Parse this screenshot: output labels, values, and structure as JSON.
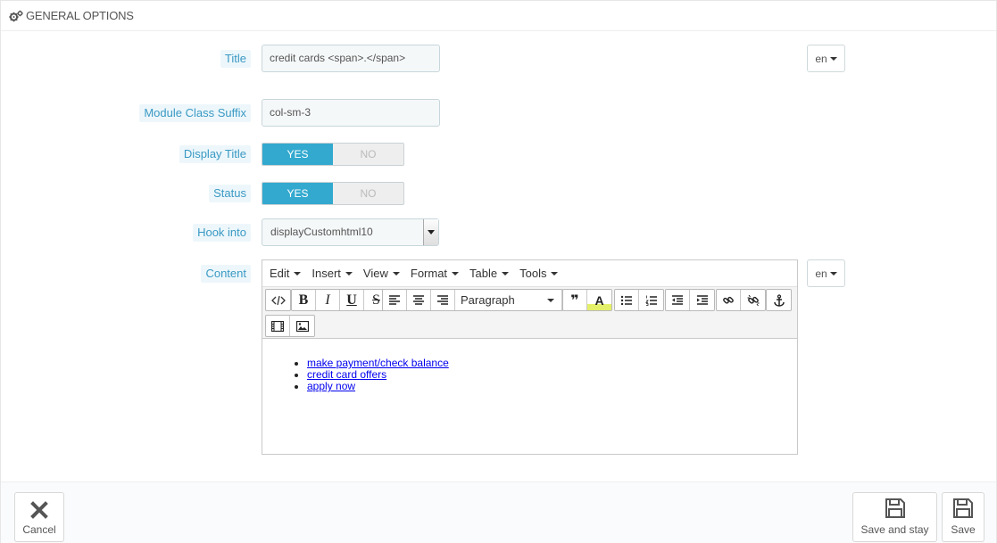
{
  "panel": {
    "heading": "GENERAL OPTIONS",
    "heading_icon": "cogs-icon"
  },
  "form": {
    "title_label": "Title",
    "title_value": "credit cards <span>.</span>",
    "lang_current": "en",
    "suffix_label": "Module Class Suffix",
    "suffix_value": "col-sm-3",
    "display_title_label": "Display Title",
    "display_title": {
      "yes": "YES",
      "no": "NO",
      "value": "YES"
    },
    "status_label": "Status",
    "status": {
      "yes": "YES",
      "no": "NO",
      "value": "YES"
    },
    "hook_label": "Hook into",
    "hook_value": "displayCustomhtml10",
    "content_label": "Content"
  },
  "editor": {
    "menus": [
      "Edit",
      "Insert",
      "View",
      "Format",
      "Table",
      "Tools"
    ],
    "block_format": "Paragraph",
    "content_links": [
      "make payment/check balance",
      "credit card offers",
      "apply now"
    ]
  },
  "footer": {
    "cancel_label": "Cancel",
    "save_stay_label": "Save and stay",
    "save_label": "Save"
  },
  "colors": {
    "accent": "#33a9cf",
    "label_text": "#3a99c4",
    "label_bg": "#edf7fb"
  }
}
